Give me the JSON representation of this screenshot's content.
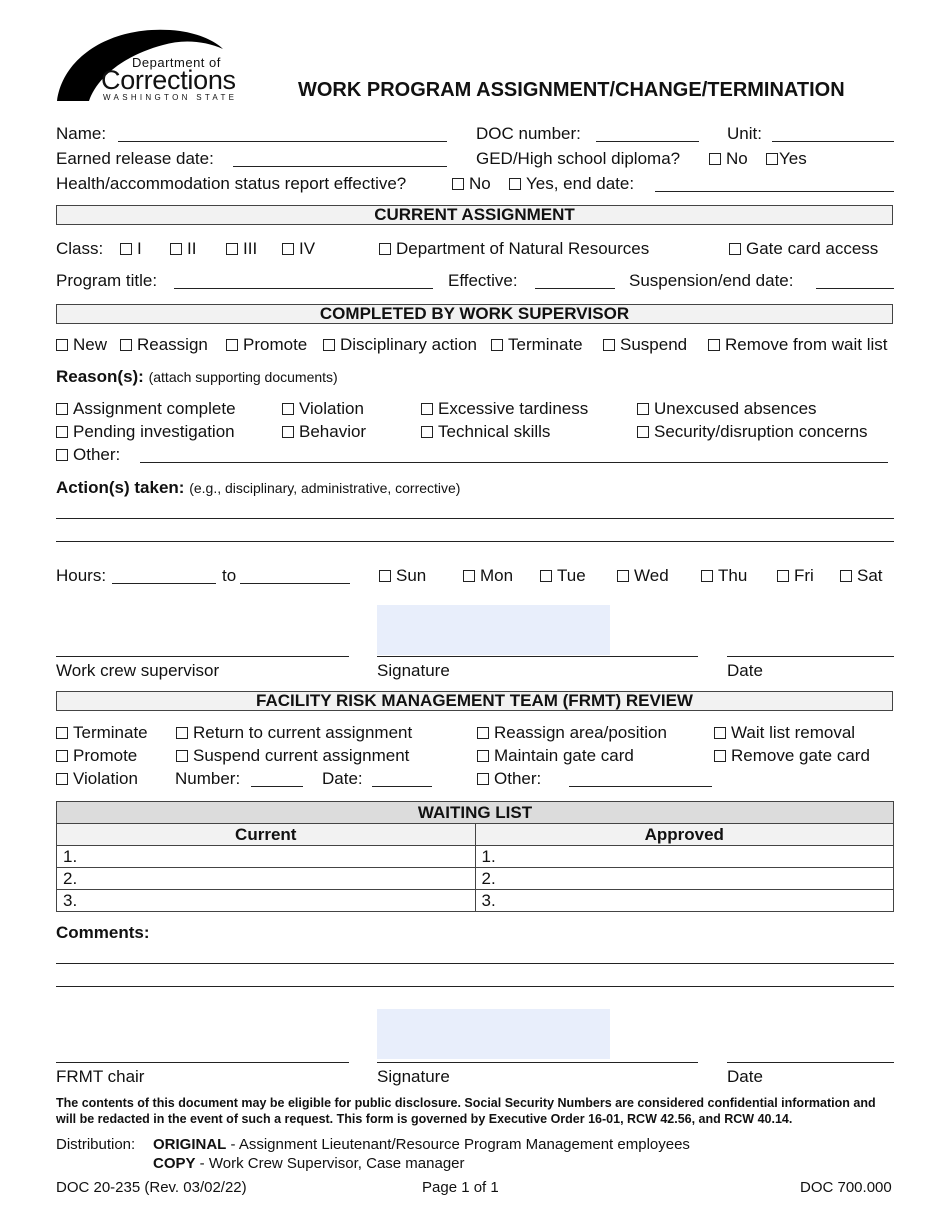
{
  "header": {
    "logo": {
      "line1": "Department of",
      "line2": "Corrections",
      "line3": "WASHINGTON STATE"
    },
    "title": "WORK PROGRAM ASSIGNMENT/CHANGE/TERMINATION"
  },
  "identity": {
    "name_label": "Name:",
    "doc_number_label": "DOC number:",
    "unit_label": "Unit:",
    "earned_release_label": "Earned release date:",
    "ged_label": "GED/High school diploma?",
    "ged_no": "No",
    "ged_yes": "Yes",
    "health_label": "Health/accommodation status report effective?",
    "health_no": "No",
    "health_yes": "Yes, end date:"
  },
  "current_assignment": {
    "heading": "CURRENT ASSIGNMENT",
    "class_label": "Class:",
    "class_options": [
      "I",
      "II",
      "III",
      "IV"
    ],
    "dnr_label": "Department of Natural Resources",
    "gate_card_label": "Gate card access",
    "program_title_label": "Program title:",
    "effective_label": "Effective:",
    "suspension_label": "Suspension/end date:"
  },
  "supervisor": {
    "heading": "COMPLETED BY WORK SUPERVISOR",
    "actions": [
      "New",
      "Reassign",
      "Promote",
      "Disciplinary action",
      "Terminate",
      "Suspend",
      "Remove from wait list"
    ],
    "reasons_label": "Reason(s):",
    "reasons_note": "(attach supporting documents)",
    "reasons_row1": [
      "Assignment complete",
      "Violation",
      "Excessive tardiness",
      "Unexcused absences"
    ],
    "reasons_row2": [
      "Pending investigation",
      "Behavior",
      "Technical skills",
      "Security/disruption concerns"
    ],
    "other_label": "Other:",
    "actions_taken_label": "Action(s) taken:",
    "actions_taken_note": "(e.g., disciplinary, administrative, corrective)",
    "hours_label": "Hours:",
    "to_label": "to",
    "days": [
      "Sun",
      "Mon",
      "Tue",
      "Wed",
      "Thu",
      "Fri",
      "Sat"
    ],
    "sig_labels": [
      "Work crew supervisor",
      "Signature",
      "Date"
    ]
  },
  "frmt": {
    "heading": "FACILITY RISK MANAGEMENT TEAM (FRMT) REVIEW",
    "col1": [
      "Terminate",
      "Promote",
      "Violation"
    ],
    "col2": [
      "Return to current assignment",
      "Suspend current assignment"
    ],
    "number_label": "Number:",
    "date_label": "Date:",
    "col3": [
      "Reassign area/position",
      "Maintain gate card",
      "Other:"
    ],
    "col4": [
      "Wait list removal",
      "Remove gate card"
    ]
  },
  "waiting_list": {
    "heading": "WAITING LIST",
    "col_current": "Current",
    "col_approved": "Approved",
    "rows": [
      {
        "current": "1.",
        "approved": "1."
      },
      {
        "current": "2.",
        "approved": "2."
      },
      {
        "current": "3.",
        "approved": "3."
      }
    ]
  },
  "comments": {
    "label": "Comments:",
    "sig_labels": [
      "FRMT chair",
      "Signature",
      "Date"
    ]
  },
  "footer": {
    "disclaimer_line1": "The contents of this document may be eligible for public disclosure.  Social Security Numbers are considered confidential information and",
    "disclaimer_line2": "will be redacted in the event of such a request.  This form is governed by Executive Order 16-01, RCW 42.56, and RCW 40.14.",
    "distribution_label": "Distribution:",
    "original_label": "ORIGINAL",
    "original_text": " - Assignment Lieutenant/Resource Program Management employees",
    "copy_label": "COPY",
    "copy_text": " - Work Crew Supervisor, Case manager",
    "form_number": "DOC 20-235 (Rev. 03/02/22)",
    "page": "Page 1 of 1",
    "policy": "DOC 700.000"
  }
}
